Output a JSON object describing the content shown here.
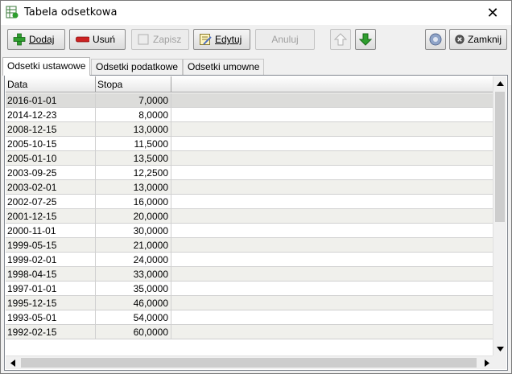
{
  "window": {
    "title": "Tabela odsetkowa"
  },
  "toolbar": {
    "add": "Dodaj",
    "delete": "Usuń",
    "save": "Zapisz",
    "edit": "Edytuj",
    "cancel": "Anuluj",
    "close": "Zamknij"
  },
  "tabs": [
    "Odsetki ustawowe",
    "Odsetki podatkowe",
    "Odsetki umowne"
  ],
  "table": {
    "columns": [
      "Data",
      "Stopa"
    ],
    "rows": [
      [
        "2016-01-01",
        "7,0000"
      ],
      [
        "2014-12-23",
        "8,0000"
      ],
      [
        "2008-12-15",
        "13,0000"
      ],
      [
        "2005-10-15",
        "11,5000"
      ],
      [
        "2005-01-10",
        "13,5000"
      ],
      [
        "2003-09-25",
        "12,2500"
      ],
      [
        "2003-02-01",
        "13,0000"
      ],
      [
        "2002-07-25",
        "16,0000"
      ],
      [
        "2001-12-15",
        "20,0000"
      ],
      [
        "2000-11-01",
        "30,0000"
      ],
      [
        "1999-05-15",
        "21,0000"
      ],
      [
        "1999-02-01",
        "24,0000"
      ],
      [
        "1998-04-15",
        "33,0000"
      ],
      [
        "1997-01-01",
        "35,0000"
      ],
      [
        "1995-12-15",
        "46,0000"
      ],
      [
        "1993-05-01",
        "54,0000"
      ],
      [
        "1992-02-15",
        "60,0000"
      ]
    ]
  },
  "colors": {
    "accent_green": "#2e9e2e",
    "delete_red": "#cc2222"
  }
}
